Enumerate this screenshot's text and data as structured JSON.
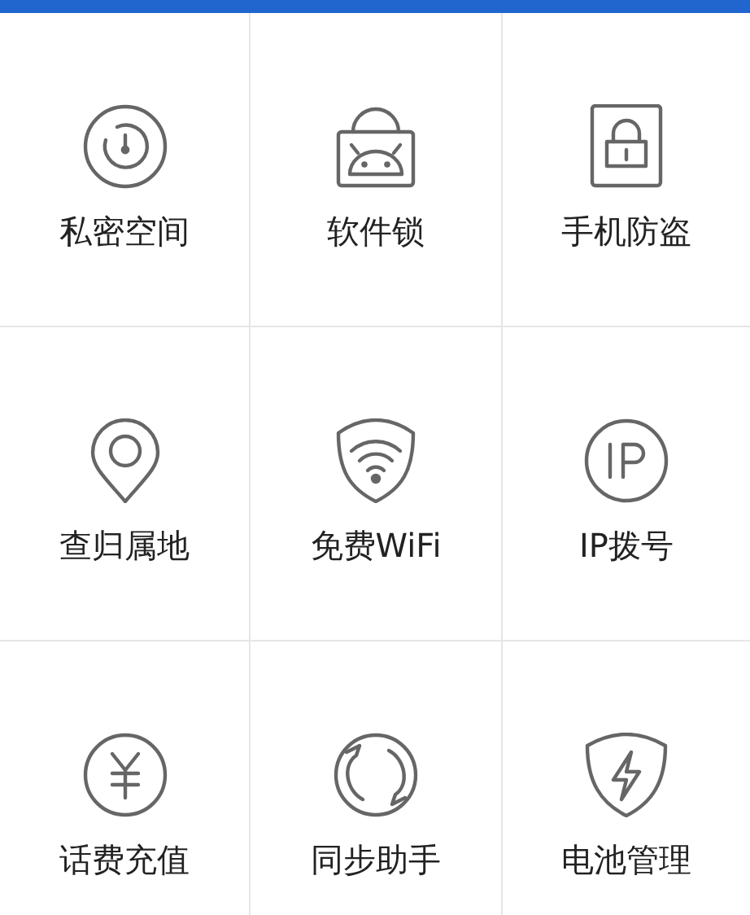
{
  "tiles": [
    {
      "kind": "dial",
      "label": "私密空间"
    },
    {
      "kind": "android-lock",
      "label": "软件锁"
    },
    {
      "kind": "phone-lock",
      "label": "手机防盗"
    },
    {
      "kind": "pin",
      "label": "查归属地"
    },
    {
      "kind": "wifi",
      "label": "免费WiFi"
    },
    {
      "kind": "ip",
      "label": "IP拨号"
    },
    {
      "kind": "yen",
      "label": "话费充值"
    },
    {
      "kind": "sync",
      "label": "同步助手"
    },
    {
      "kind": "shield",
      "label": "电池管理"
    }
  ]
}
